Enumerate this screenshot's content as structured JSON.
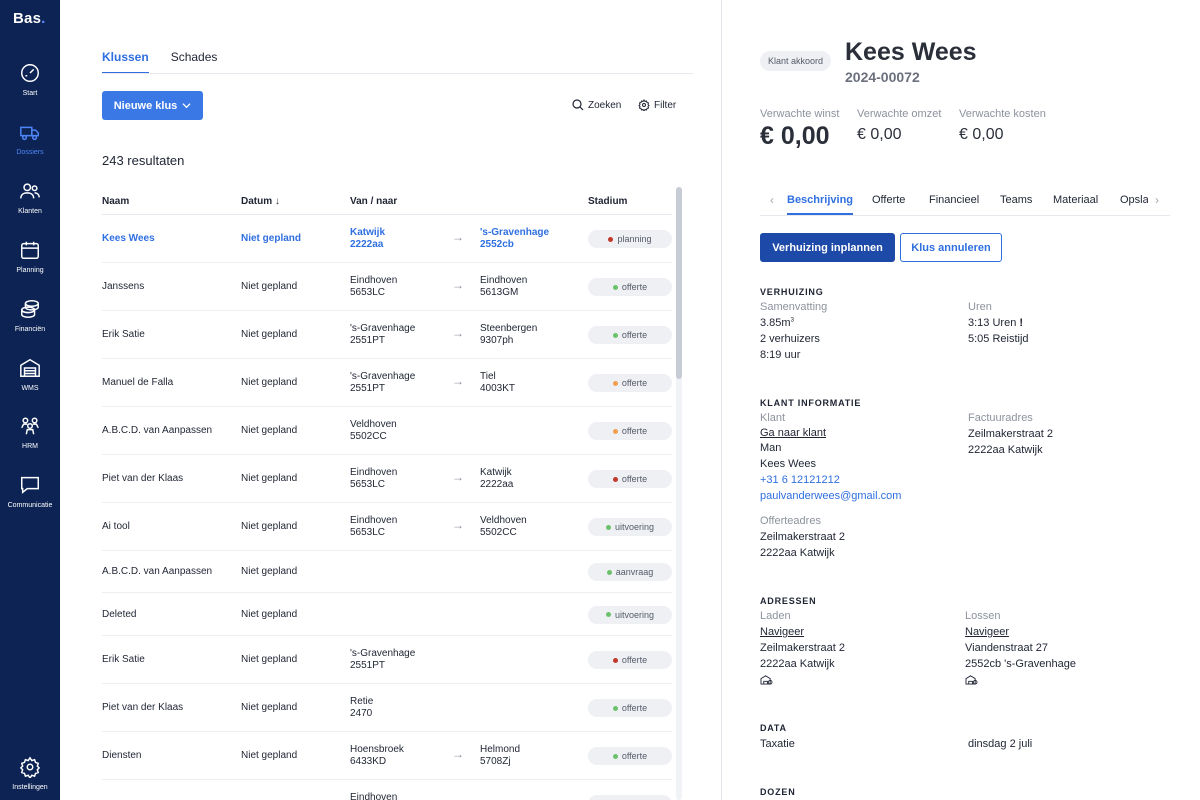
{
  "app": {
    "logo": "Bas",
    "logo_dot": "."
  },
  "sidebar": {
    "items": [
      {
        "label": "Start",
        "icon": "gauge-icon"
      },
      {
        "label": "Dossiers",
        "icon": "truck-icon",
        "active": true
      },
      {
        "label": "Klanten",
        "icon": "users-icon"
      },
      {
        "label": "Planning",
        "icon": "calendar-icon"
      },
      {
        "label": "Financiën",
        "icon": "coins-icon"
      },
      {
        "label": "WMS",
        "icon": "warehouse-icon"
      },
      {
        "label": "HRM",
        "icon": "team-icon"
      },
      {
        "label": "Communicatie",
        "icon": "chat-icon"
      },
      {
        "label": "Instellingen",
        "icon": "gear-icon"
      }
    ]
  },
  "list": {
    "tabs": [
      "Klussen",
      "Schades"
    ],
    "new_button": "Nieuwe klus",
    "search_label": "Zoeken",
    "filter_label": "Filter",
    "results_text": "243 resultaten",
    "columns": {
      "name": "Naam",
      "date": "Datum",
      "route": "Van / naar",
      "stage": "Stadium"
    },
    "rows": [
      {
        "name": "Kees Wees",
        "date": "Niet gepland",
        "from": [
          "Katwijk",
          "2222aa"
        ],
        "to": [
          "'s-Gravenhage",
          "2552cb"
        ],
        "stage": "planning",
        "stage_color": "#c0392b",
        "highlight": true
      },
      {
        "name": "Janssens",
        "date": "Niet gepland",
        "from": [
          "Eindhoven",
          "5653LC"
        ],
        "to": [
          "Eindhoven",
          "5613GM"
        ],
        "stage": "offerte",
        "stage_color": "#6cc26c"
      },
      {
        "name": "Erik Satie",
        "date": "Niet gepland",
        "from": [
          "'s-Gravenhage",
          "2551PT"
        ],
        "to": [
          "Steenbergen",
          "9307ph"
        ],
        "stage": "offerte",
        "stage_color": "#6cc26c"
      },
      {
        "name": "Manuel de Falla",
        "date": "Niet gepland",
        "from": [
          "'s-Gravenhage",
          "2551PT"
        ],
        "to": [
          "Tiel",
          "4003KT"
        ],
        "stage": "offerte",
        "stage_color": "#f0a050"
      },
      {
        "name": "A.B.C.D. van Aanpassen",
        "date": "Niet gepland",
        "from": [
          "Veldhoven",
          "5502CC"
        ],
        "to": null,
        "stage": "offerte",
        "stage_color": "#f0a050"
      },
      {
        "name": "Piet van der Klaas",
        "date": "Niet gepland",
        "from": [
          "Eindhoven",
          "5653LC"
        ],
        "to": [
          "Katwijk",
          "2222aa"
        ],
        "stage": "offerte",
        "stage_color": "#c0392b"
      },
      {
        "name": "Ai tool",
        "date": "Niet gepland",
        "from": [
          "Eindhoven",
          "5653LC"
        ],
        "to": [
          "Veldhoven",
          "5502CC"
        ],
        "stage": "uitvoering",
        "stage_color": "#6cc26c"
      },
      {
        "name": "A.B.C.D. van Aanpassen",
        "date": "Niet gepland",
        "from": null,
        "to": null,
        "stage": "aanvraag",
        "stage_color": "#6cc26c"
      },
      {
        "name": "Deleted",
        "date": "Niet gepland",
        "from": null,
        "to": null,
        "stage": "uitvoering",
        "stage_color": "#6cc26c"
      },
      {
        "name": "Erik Satie",
        "date": "Niet gepland",
        "from": [
          "'s-Gravenhage",
          "2551PT"
        ],
        "to": null,
        "stage": "offerte",
        "stage_color": "#c0392b"
      },
      {
        "name": "Piet van der Klaas",
        "date": "Niet gepland",
        "from": [
          "Retie",
          "2470"
        ],
        "to": null,
        "stage": "offerte",
        "stage_color": "#6cc26c"
      },
      {
        "name": "Diensten",
        "date": "Niet gepland",
        "from": [
          "Hoensbroek",
          "6433KD"
        ],
        "to": [
          "Helmond",
          "5708Zj"
        ],
        "stage": "offerte",
        "stage_color": "#6cc26c"
      },
      {
        "name": "",
        "date": "",
        "from": [
          "Eindhoven",
          ""
        ],
        "to": null,
        "stage": "",
        "stage_color": "#eef0f4"
      }
    ]
  },
  "detail": {
    "status_chip": "Klant akkoord",
    "name": "Kees Wees",
    "id": "2024-00072",
    "metrics": [
      {
        "label": "Verwachte winst",
        "value": "€ 0,00"
      },
      {
        "label": "Verwachte omzet",
        "value": "€ 0,00"
      },
      {
        "label": "Verwachte kosten",
        "value": "€ 0,00"
      }
    ],
    "tabs": [
      "Beschrijving",
      "Offerte",
      "Financieel",
      "Teams",
      "Materiaal",
      "Opsla"
    ],
    "primary_button": "Verhuizing inplannen",
    "secondary_button": "Klus annuleren",
    "verhuizing": {
      "title": "VERHUIZING",
      "summary_label": "Samenvatting",
      "volume": "3.85m",
      "volume_sup": "3",
      "movers": "2 verhuizers",
      "time": "8:19 uur",
      "hours_label": "Uren",
      "hours": "3:13 Uren",
      "hours_flag": "!",
      "travel": "5:05 Reistijd"
    },
    "klant": {
      "title": "KLANT INFORMATIE",
      "client_label": "Klant",
      "client_link": "Ga naar klant",
      "gender": "Man",
      "name": "Kees Wees",
      "phone": "+31 6 12121212",
      "email": "paulvanderwees@gmail.com",
      "invoice_label": "Factuuradres",
      "invoice_line1": "Zeilmakerstraat 2",
      "invoice_line2": "2222aa Katwijk",
      "quote_label": "Offerteadres",
      "quote_line1": "Zeilmakerstraat 2",
      "quote_line2": "2222aa Katwijk"
    },
    "adressen": {
      "title": "ADRESSEN",
      "load_label": "Laden",
      "load_nav": "Navigeer",
      "load_line1": "Zeilmakerstraat 2",
      "load_line2": "2222aa Katwijk",
      "unload_label": "Lossen",
      "unload_nav": "Navigeer",
      "unload_line1": "Viandenstraat 27",
      "unload_line2": "2552cb 's-Gravenhage"
    },
    "data": {
      "title": "DATA",
      "taxatie_label": "Taxatie",
      "taxatie_value": "dinsdag 2 juli"
    },
    "dozen": {
      "title": "DOZEN"
    }
  }
}
